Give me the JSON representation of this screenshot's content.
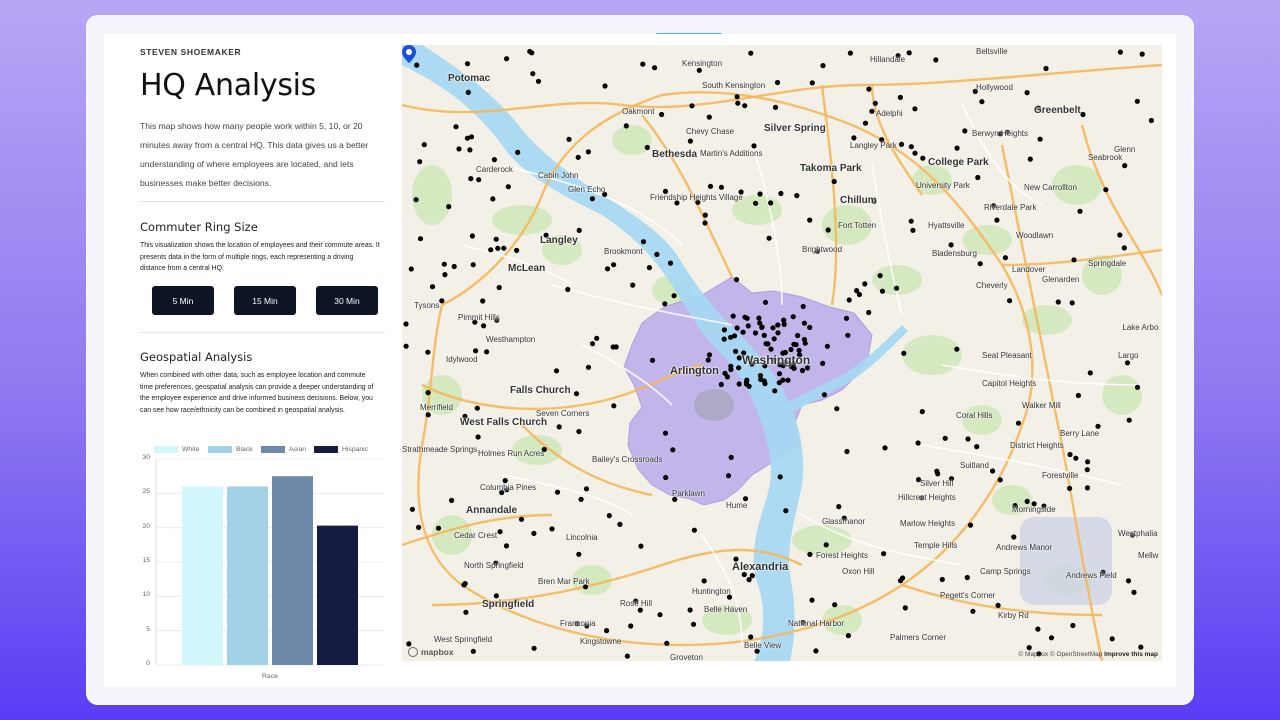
{
  "header": {
    "author": "STEVEN SHOEMAKER",
    "title": "HQ Analysis",
    "intro": "This map shows how many people work within 5, 10, or 20 minutes away from a central HQ. This data gives us a better understanding of where employees are located, and lets businesses make better decisions."
  },
  "commuter": {
    "title": "Commuter Ring Size",
    "text": "This visualization shows the location of employees and their commute areas. It presents data in the form of multiple rings, each representing a driving distance from a central HQ.",
    "buttons": [
      "5 Min",
      "15 Min",
      "30 Min"
    ]
  },
  "geospatial": {
    "title": "Geospatial Analysis",
    "text": "When combined with other data, such as employee location and commute time preferences, geospatial analysis can provide a deeper understanding of the employee experience and drive informed business decisions. Below, you can see how race/ethnicity can be combined in geospatial analysis."
  },
  "chart_data": {
    "type": "bar",
    "categories": [
      "Race"
    ],
    "series": [
      {
        "name": "White",
        "values": [
          26
        ],
        "color": "#d2f7fd"
      },
      {
        "name": "Black",
        "values": [
          26
        ],
        "color": "#a3d2e7"
      },
      {
        "name": "Asian",
        "values": [
          27.5
        ],
        "color": "#6e8aa8"
      },
      {
        "name": "Hispanic",
        "values": [
          20.3
        ],
        "color": "#141c42"
      }
    ],
    "xlabel": "Race",
    "ylim": [
      0,
      30
    ],
    "yticks": [
      0,
      5,
      10,
      15,
      20,
      25,
      30
    ],
    "legend": "top",
    "grid": true
  },
  "map": {
    "labels": [
      "Potomac",
      "Kensington",
      "South Kensington",
      "Hillandale",
      "Beltsville",
      "Adelphi",
      "Greenbelt",
      "Glenn",
      "Oakmont",
      "Chevy Chase",
      "Silver Spring",
      "Langley Park",
      "Berwyn Heights",
      "Seabrook",
      "Bethesda",
      "Martin's Additions",
      "Takoma Park",
      "College Park",
      "Carderock",
      "Cabin John",
      "Glen Echo",
      "University Park",
      "New Carrollton",
      "Friendship Heights Village",
      "Chillum",
      "Riverdale Park",
      "Langley",
      "Brookmont",
      "Hyattsville",
      "Woodlawn",
      "McLean",
      "Bladensburg",
      "Springdale",
      "Tysons",
      "Landover",
      "Glenarden",
      "Cheverly",
      "Pimmit Hills",
      "Westhampton",
      "Lake Arbo",
      "Idylwood",
      "Washington",
      "Seat Pleasant",
      "Largo",
      "Arlington",
      "Falls Church",
      "Capitol Heights",
      "Merrifield",
      "Seven Corners",
      "Walker Mill",
      "West Falls Church",
      "Coral Hills",
      "Berry Lane",
      "District Heights",
      "Strathmeade Springs",
      "Holmes Run Acres",
      "Bailey's Crossroads",
      "Suitland",
      "Forestville",
      "Columbia Pines",
      "Parklawn",
      "Silver Hill",
      "Annandale",
      "Hillcrest Heights",
      "Morningside",
      "Hume",
      "Marlow Heights",
      "Westphalia",
      "Cedar Crest",
      "Lincolnia",
      "Temple Hills",
      "Andrews Manor",
      "Mellw",
      "Glassmanor",
      "Forest Heights",
      "North Springfield",
      "Alexandria",
      "Oxon Hill",
      "Camp Springs",
      "Andrews Field",
      "Bren Mar Park",
      "Huntington",
      "Springfield",
      "Rose Hill",
      "Belle Haven",
      "Pegett's Corner",
      "Franconia",
      "National Harbor",
      "Kingstowne",
      "West Springfield",
      "Belle View",
      "Palmers Corner",
      "Groveton",
      "Kirby Rd",
      "Hollywood",
      "Fort Totten",
      "Brightwood"
    ],
    "attribution": "© Mapbox © OpenStreetMap",
    "improve": "Improve this map",
    "logo": "mapbox"
  },
  "colors": {
    "button_bg": "#0d1424",
    "ring_fill": "#b7a9ea",
    "water": "#a7d8f2",
    "park": "#cfe8b8",
    "road": "#f4b75a",
    "accent": "#37b6f0"
  }
}
